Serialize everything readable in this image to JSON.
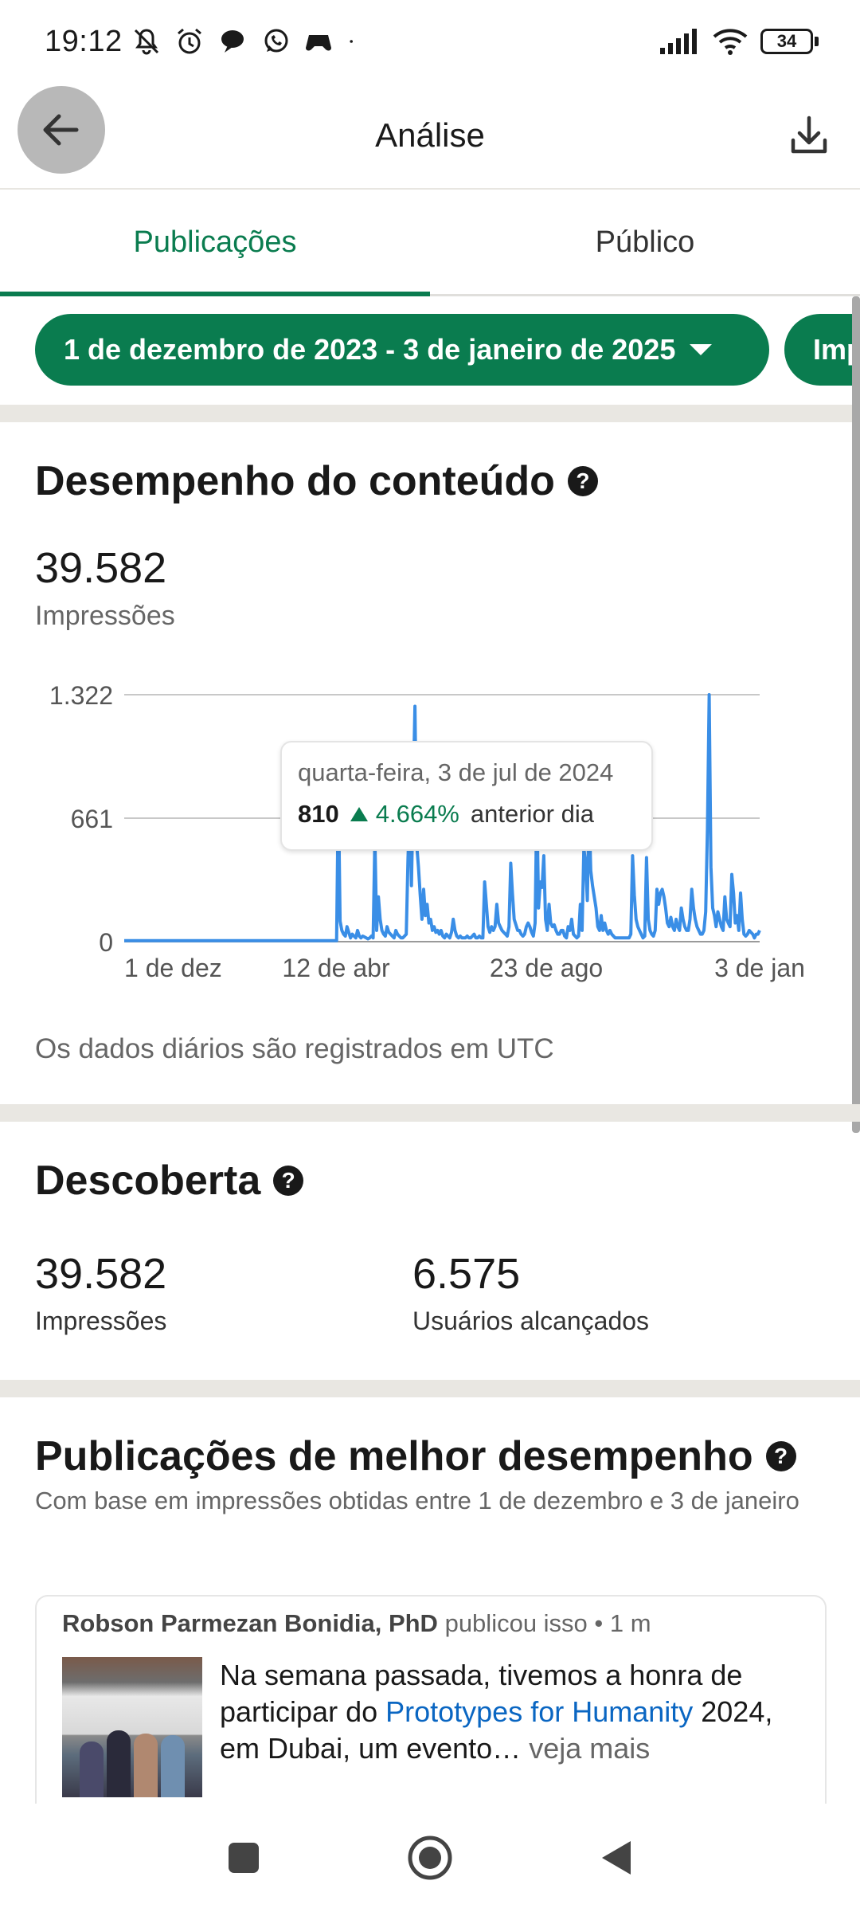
{
  "status_bar": {
    "time": "19:12",
    "battery": "34",
    "icons": [
      "mute-icon",
      "alarm-icon",
      "chat-bubble-icon",
      "whatsapp-icon",
      "game-icon",
      "dot-icon",
      "signal-icon",
      "wifi-icon",
      "battery-icon"
    ]
  },
  "app_bar": {
    "title": "Análise"
  },
  "tabs": [
    {
      "label": "Publicações",
      "active": true
    },
    {
      "label": "Público",
      "active": false
    }
  ],
  "filters": {
    "date_range": "1 de dezembro de 2023 - 3 de janeiro de 2025",
    "second_chip": "Imp"
  },
  "content_performance": {
    "title": "Desempenho do conteúdo",
    "total": "39.582",
    "total_label": "Impressões",
    "utc_note": "Os dados diários são registrados em UTC"
  },
  "chart_data": {
    "type": "line",
    "y_ticks": [
      "1.322",
      "661",
      "0"
    ],
    "ylim": [
      0,
      1322
    ],
    "x_ticks": [
      "1 de dez",
      "12 de abr",
      "23 de ago",
      "3 de jan"
    ],
    "series_color": "#3a8ee6",
    "series": [
      {
        "name": "",
        "values": [
          5,
          5,
          5,
          5,
          5,
          5,
          5,
          5,
          5,
          5,
          5,
          5,
          5,
          5,
          5,
          5,
          5,
          5,
          5,
          5,
          5,
          5,
          5,
          5,
          5,
          5,
          5,
          5,
          5,
          5,
          5,
          5,
          5,
          5,
          5,
          5,
          5,
          5,
          5,
          5,
          5,
          5,
          5,
          5,
          5,
          5,
          5,
          5,
          5,
          5,
          5,
          5,
          5,
          5,
          5,
          5,
          5,
          5,
          5,
          5,
          5,
          5,
          5,
          5,
          5,
          5,
          5,
          5,
          5,
          5,
          5,
          5,
          5,
          5,
          5,
          5,
          5,
          5,
          5,
          5,
          5,
          5,
          5,
          5,
          5,
          5,
          5,
          5,
          5,
          5,
          5,
          5,
          5,
          5,
          5,
          5,
          5,
          5,
          5,
          5,
          5,
          5,
          5,
          5,
          5,
          5,
          5,
          5,
          5,
          5,
          5,
          5,
          5,
          5,
          5,
          5,
          5,
          5,
          5,
          5,
          5,
          5,
          5,
          820,
          110,
          60,
          40,
          30,
          80,
          50,
          20,
          40,
          30,
          20,
          60,
          30,
          20,
          30,
          25,
          20,
          15,
          20,
          30,
          20,
          560,
          60,
          240,
          120,
          60,
          40,
          30,
          80,
          50,
          40,
          30,
          20,
          60,
          40,
          30,
          20,
          20,
          30,
          40,
          450,
          720,
          300,
          800,
          1260,
          520,
          400,
          250,
          120,
          280,
          140,
          200,
          100,
          120,
          60,
          80,
          50,
          60,
          40,
          60,
          30,
          20,
          40,
          30,
          20,
          50,
          120,
          60,
          30,
          20,
          30,
          20,
          20,
          20,
          30,
          20,
          20,
          30,
          40,
          20,
          20,
          30,
          20,
          20,
          320,
          200,
          80,
          50,
          80,
          60,
          80,
          200,
          100,
          80,
          60,
          50,
          40,
          30,
          80,
          420,
          260,
          120,
          90,
          60,
          60,
          40,
          30,
          40,
          80,
          100,
          80,
          50,
          30,
          100,
          760,
          180,
          320,
          290,
          460,
          120,
          60,
          200,
          100,
          80,
          90,
          60,
          40,
          40,
          60,
          60,
          30,
          20,
          80,
          60,
          120,
          40,
          30,
          20,
          30,
          200,
          60,
          500,
          420,
          220,
          720,
          380,
          300,
          240,
          180,
          80,
          60,
          140,
          60,
          100,
          60,
          40,
          60,
          40,
          30,
          20,
          20,
          20,
          20,
          20,
          20,
          20,
          20,
          20,
          40,
          460,
          250,
          120,
          80,
          60,
          40,
          20,
          30,
          450,
          120,
          60,
          40,
          30,
          60,
          280,
          200,
          260,
          280,
          240,
          180,
          100,
          80,
          130,
          80,
          60,
          120,
          80,
          60,
          180,
          120,
          80,
          60,
          60,
          120,
          280,
          180,
          120,
          80,
          60,
          40,
          40,
          60,
          160,
          600,
          1322,
          400,
          180,
          140,
          80,
          160,
          120,
          80,
          60,
          240,
          120,
          100,
          80,
          360,
          260,
          100,
          140,
          60,
          260,
          120,
          40,
          30,
          40,
          60,
          50,
          40,
          20,
          40,
          40,
          60
        ]
      }
    ],
    "tooltip": {
      "date": "quarta-feira, 3 de jul de 2024",
      "value": "810",
      "change": "4.664%",
      "suffix": "anterior dia"
    }
  },
  "discovery": {
    "title": "Descoberta",
    "impressions_value": "39.582",
    "impressions_label": "Impressões",
    "reach_value": "6.575",
    "reach_label": "Usuários alcançados"
  },
  "top_posts": {
    "title": "Publicações de melhor desempenho",
    "subtitle": "Com base em impressões obtidas entre 1 de dezembro e 3 de janeiro",
    "post": {
      "author": "Robson Parmezan Bonidia, PhD",
      "meta": "publicou isso • 1 m",
      "text_before": "Na semana passada, tivemos a honra de participar do ",
      "link": "Prototypes for Humanity",
      "text_after": " 2024, em Dubai, um evento…",
      "more": " veja mais"
    }
  }
}
